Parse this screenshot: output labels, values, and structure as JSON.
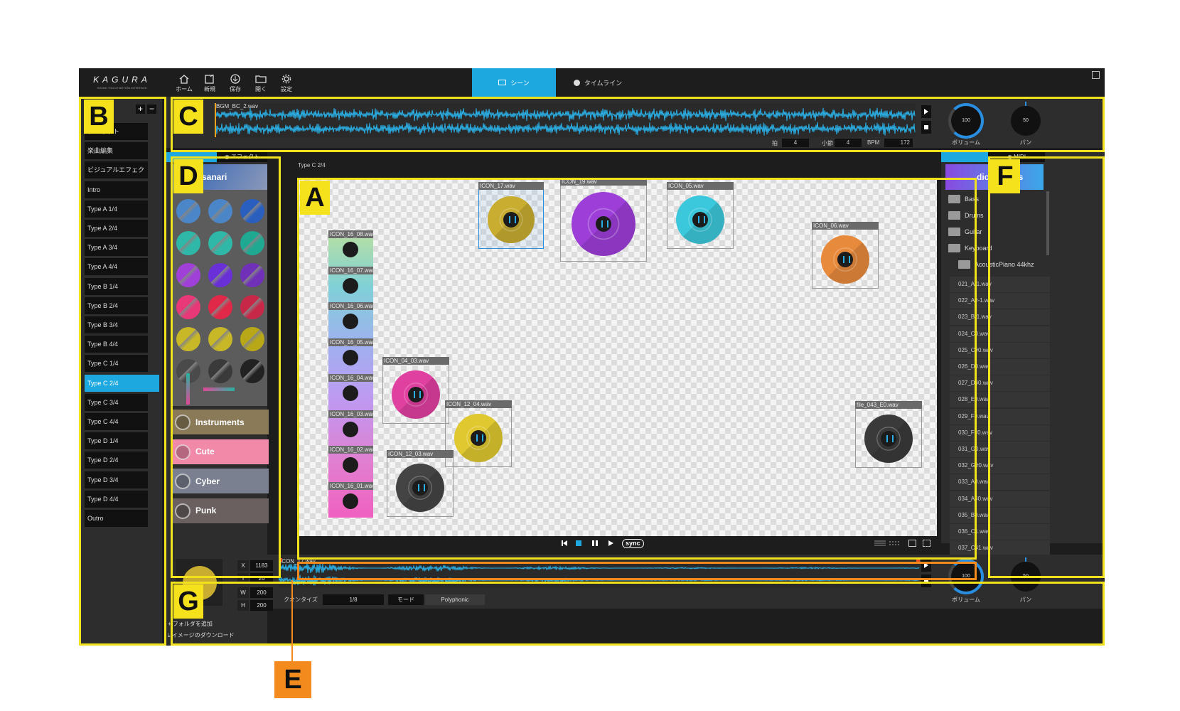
{
  "toolbar": {
    "logo": "KAGURA",
    "logo_sub": "SOUND TOUCH MOTION INTERFACE",
    "home": "ホーム",
    "new": "新規",
    "save": "保存",
    "open": "開く",
    "settings": "設定",
    "scene_tab": "シーン",
    "timeline_tab": "タイムライン"
  },
  "badges": {
    "A": "A",
    "B": "B",
    "C": "C",
    "D": "D",
    "E": "E",
    "F": "F",
    "G": "G"
  },
  "scenes": {
    "items": [
      "プリセット",
      "楽曲編集",
      "ビジュアルエフェクト",
      "Intro",
      "Type A 1/4",
      "Type A 2/4",
      "Type A 3/4",
      "Type A 4/4",
      "Type B 1/4",
      "Type B 2/4",
      "Type B 3/4",
      "Type B 4/4",
      "Type C 1/4",
      "Type C 2/4",
      "Type C 3/4",
      "Type C 4/4",
      "Type D 1/4",
      "Type D 2/4",
      "Type D 3/4",
      "Type D 4/4",
      "Outro"
    ],
    "selected": "Type C 2/4",
    "add": "+",
    "remove": "−"
  },
  "bgm": {
    "file": "BGM_BC_2.wav",
    "beat_label": "拍",
    "beat_value": "4",
    "bar_label": "小節",
    "bar_value": "4",
    "bpm_label": "BPM",
    "bpm_value": "172",
    "volume_value": "100",
    "volume_label": "ボリューム",
    "pan_value": "50",
    "pan_label": "パン"
  },
  "palette": {
    "tab_effect": "エフェクト",
    "header": "sanari",
    "categories": [
      "Instruments",
      "Cute",
      "Cyber",
      "Punk"
    ],
    "add_folder": "フォルダを追加",
    "download_image": "イメージのダウンロード",
    "colors": [
      "#4a86c8",
      "#4a86c8",
      "#2a5fc0",
      "#2fb8a8",
      "#2fb8a8",
      "#1fa892",
      "#a040d8",
      "#6a30d8",
      "#7030b8",
      "#e83878",
      "#e02848",
      "#c82848",
      "#c8b828",
      "#c8b828",
      "#b8a818",
      "#4a4a4a",
      "#3a3a3a",
      "#222222"
    ]
  },
  "stage": {
    "title": "Type C 2/4",
    "items": [
      {
        "label": "ICON_17.wav",
        "color": "#c8ad30"
      },
      {
        "label": "ICON_19.wav",
        "color": "#9d3ed8"
      },
      {
        "label": "ICON_05.wav",
        "color": "#3cc8dc"
      },
      {
        "label": "ICON_06.wav",
        "color": "#e88a3c"
      },
      {
        "label": "ICON_04_03.wav",
        "color": "#e040a0"
      },
      {
        "label": "ICON_12_04.wav",
        "color": "#e0c830"
      },
      {
        "label": "ICON_12_03.wav",
        "color": "#444444"
      },
      {
        "label": "file_043_E0.wav",
        "color": "#3a3a3a"
      }
    ],
    "stack": [
      "ICON_16_08.wav",
      "ICON_16_07.wav",
      "ICON_16_06.wav",
      "ICON_16_05.wav",
      "ICON_16_04.wav",
      "ICON_16_03.wav",
      "ICON_16_02.wav",
      "ICON_16_01.wav"
    ]
  },
  "player": {
    "sync": "sync"
  },
  "library": {
    "tab_midi": "MIDI",
    "header": "dio Sounds",
    "folders": [
      "Bass",
      "Drums",
      "Guitar",
      "Keyboard",
      "AcousticPiano 44khz"
    ],
    "files": [
      "021_A-1.wav",
      "022_A#-1.wav",
      "023_B-1.wav",
      "024_C0.wav",
      "025_C#0.wav",
      "026_D0.wav",
      "027_D#0.wav",
      "028_E0.wav",
      "029_F0.wav",
      "030_F#0.wav",
      "031_G0.wav",
      "032_G#0.wav",
      "033_A0.wav",
      "034_A#0.wav",
      "035_B0.wav",
      "036_C1.wav",
      "037_C#1.wav"
    ]
  },
  "inspector": {
    "x_label": "X",
    "x_value": "1183",
    "y_label": "Y",
    "y_value": "26",
    "w_label": "W",
    "w_value": "200",
    "h_label": "H",
    "h_value": "200",
    "file": "ICON_17.wav",
    "quantize_label": "クオンタイズ",
    "quantize_value": "1/8",
    "mode_label": "モード",
    "mode_value": "Polyphonic",
    "volume_value": "100",
    "volume_label": "ボリューム",
    "pan_value": "50",
    "pan_label": "パン"
  }
}
